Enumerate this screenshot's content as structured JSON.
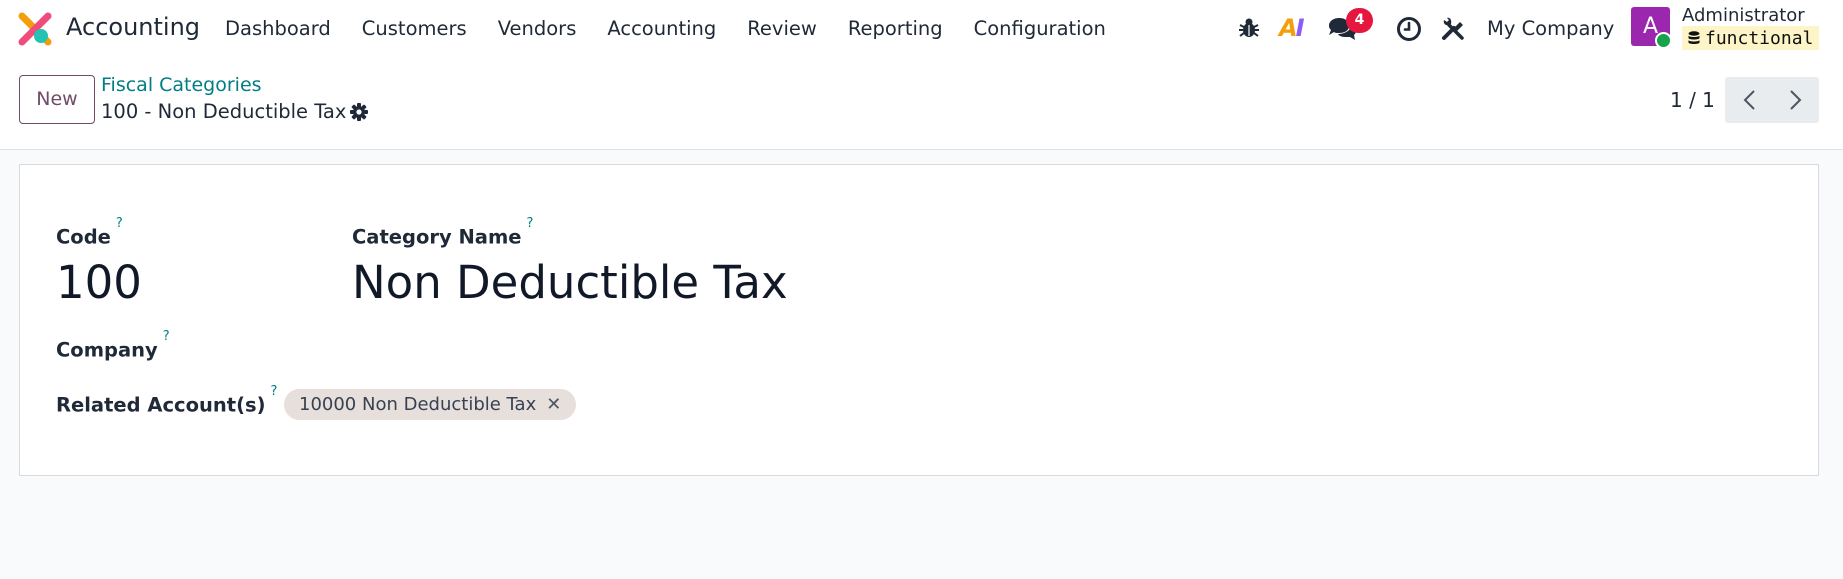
{
  "navbar": {
    "app_name": "Accounting",
    "menu": [
      "Dashboard",
      "Customers",
      "Vendors",
      "Accounting",
      "Review",
      "Reporting",
      "Configuration"
    ],
    "messages_count": "4",
    "company": "My Company",
    "user": {
      "avatar_letter": "A",
      "name": "Administrator",
      "database": "functional"
    },
    "colors": {
      "accent": "#714b67",
      "link": "#017e84",
      "badge": "#e5173f",
      "avatar": "#9b27af"
    },
    "icons": [
      "app-logo-icon",
      "bug-icon",
      "ai-icon",
      "chat-icon",
      "clock-icon",
      "tools-icon",
      "database-icon"
    ]
  },
  "control_panel": {
    "new_label": "New",
    "breadcrumb": "Fiscal Categories",
    "record_title": "100 - Non Deductible Tax",
    "pager": "1 / 1"
  },
  "form": {
    "code_label": "Code",
    "code_value": "100",
    "name_label": "Category Name",
    "name_value": "Non Deductible Tax",
    "company_label": "Company",
    "company_value": "",
    "accounts_label": "Related Account(s)",
    "accounts": [
      "10000 Non Deductible Tax"
    ],
    "help_marker": "?"
  }
}
